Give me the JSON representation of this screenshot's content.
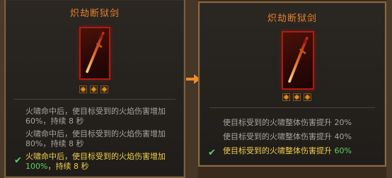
{
  "before": {
    "title": "炽劫断狱剑",
    "lines": [
      {
        "text": "火啸命中后，使目标受到的火焰伤害增加",
        "value_line": "60%，持续 8 秒"
      },
      {
        "text": "火啸命中后，使目标受到的火焰伤害增加",
        "value_line": "80%，持续 8 秒"
      },
      {
        "text": "火啸命中后，使目标受到的火焰伤害增加",
        "value": "100%",
        "suffix": "，持续 8 秒"
      }
    ]
  },
  "after": {
    "title": "炽劫断狱剑",
    "lines": [
      {
        "text": "使目标受到的火啸整体伤害提升",
        "value": "20%"
      },
      {
        "text": "使目标受到的火啸整体伤害提升",
        "value": "40%"
      },
      {
        "text": "使目标受到的火啸整体伤害提升",
        "value": "60%"
      }
    ]
  },
  "icons": {
    "check": "checkmark-icon",
    "arrow": "right-arrow-icon",
    "gem": "rune-socket-icon"
  },
  "colors": {
    "title": "#e9802d",
    "text": "#a8a49a",
    "active_text": "#f0cf4a",
    "active_value": "#5fd35b",
    "arrow": "#f08a2a",
    "card_border": "#b31a10"
  }
}
